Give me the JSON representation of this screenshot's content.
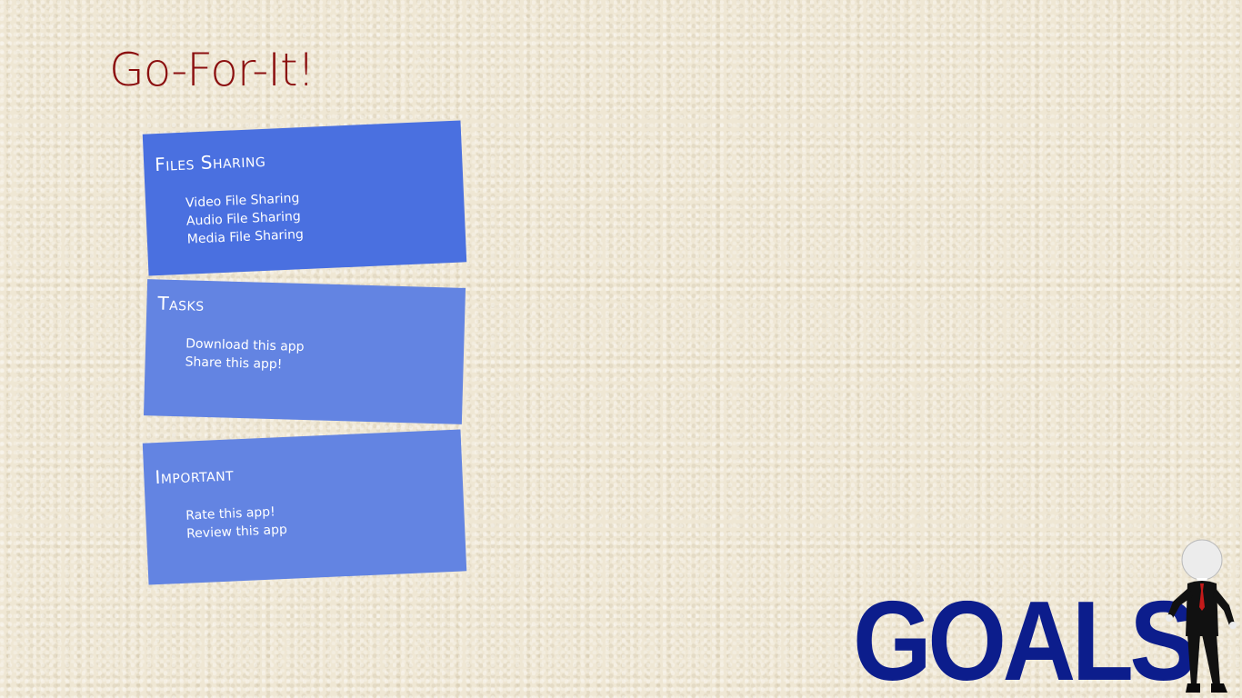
{
  "app": {
    "title": "Go-For-It!"
  },
  "tiles": [
    {
      "header": "Files Sharing",
      "items": [
        "Video File Sharing",
        "Audio File Sharing",
        "Media File Sharing"
      ],
      "color": "#4a70e0"
    },
    {
      "header": "Tasks",
      "items": [
        "Download this app",
        "Share this app!"
      ],
      "color": "#6384e2"
    },
    {
      "header": "Important",
      "items": [
        "Rate this app!",
        "Review this app"
      ],
      "color": "#6384e2"
    }
  ],
  "graphic": {
    "word": "GOALS",
    "word_color": "#0c1d8c",
    "figure_icon": "leaning-person-figure-icon"
  },
  "colors": {
    "background": "#efe7d4",
    "title": "#8b0f0f"
  }
}
